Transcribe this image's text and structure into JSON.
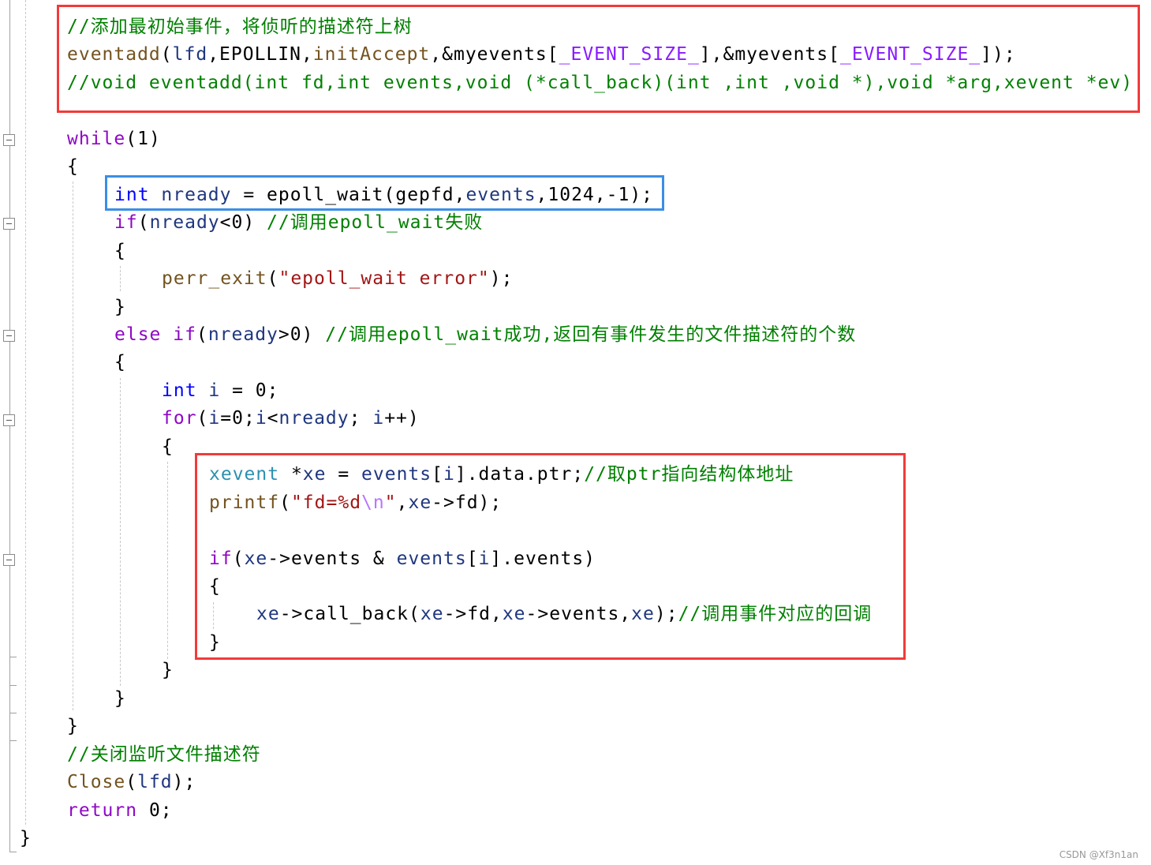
{
  "colors": {
    "comment": "#008000",
    "keyword": "#8f08c4",
    "type": "#0000ff",
    "function": "#74531f",
    "variable": "#1f377f",
    "macro": "#8a1bff",
    "string": "#a31515",
    "highlight_red": "#f23a3a",
    "highlight_blue": "#3a8ee6"
  },
  "code_lines": [
    {
      "indent": 1,
      "tokens": [
        [
          "//添加最初始事件，将侦听的描述符上树",
          "comment"
        ]
      ]
    },
    {
      "indent": 1,
      "tokens": [
        [
          "eventadd",
          "fn"
        ],
        [
          "(",
          "plain"
        ],
        [
          "lfd",
          "var"
        ],
        [
          ",EPOLLIN,",
          "plain"
        ],
        [
          "initAccept",
          "fn"
        ],
        [
          ",&myevents[",
          "plain"
        ],
        [
          "_EVENT_SIZE_",
          "macro"
        ],
        [
          "],&myevents[",
          "plain"
        ],
        [
          "_EVENT_SIZE_",
          "macro"
        ],
        [
          "]);",
          "plain"
        ]
      ]
    },
    {
      "indent": 1,
      "tokens": [
        [
          "//void eventadd(int fd,int events,void (*call_back)(int ,int ,void *),void *arg,xevent *ev)",
          "comment"
        ]
      ]
    },
    {
      "indent": 1,
      "tokens": []
    },
    {
      "indent": 1,
      "tokens": [
        [
          "while",
          "kw"
        ],
        [
          "(1)",
          "plain"
        ]
      ]
    },
    {
      "indent": 1,
      "tokens": [
        [
          "{",
          "plain"
        ]
      ]
    },
    {
      "indent": 2,
      "tokens": [
        [
          "int",
          "type"
        ],
        [
          " ",
          "plain"
        ],
        [
          "nready",
          "var"
        ],
        [
          " = epoll_wait(gepfd,",
          "plain"
        ],
        [
          "events",
          "var"
        ],
        [
          ",1024,-1);",
          "plain"
        ]
      ]
    },
    {
      "indent": 2,
      "tokens": [
        [
          "if",
          "kw"
        ],
        [
          "(",
          "plain"
        ],
        [
          "nready",
          "var"
        ],
        [
          "<0) ",
          "plain"
        ],
        [
          "//调用epoll_wait失败",
          "comment"
        ]
      ]
    },
    {
      "indent": 2,
      "tokens": [
        [
          "{",
          "plain"
        ]
      ]
    },
    {
      "indent": 3,
      "tokens": [
        [
          "perr_exit",
          "fn"
        ],
        [
          "(",
          "plain"
        ],
        [
          "\"epoll_wait error\"",
          "str"
        ],
        [
          ");",
          "plain"
        ]
      ]
    },
    {
      "indent": 2,
      "tokens": [
        [
          "}",
          "plain"
        ]
      ]
    },
    {
      "indent": 2,
      "tokens": [
        [
          "else",
          "kw"
        ],
        [
          " ",
          "plain"
        ],
        [
          "if",
          "kw"
        ],
        [
          "(",
          "plain"
        ],
        [
          "nready",
          "var"
        ],
        [
          ">0) ",
          "plain"
        ],
        [
          "//调用epoll_wait成功,返回有事件发生的文件描述符的个数",
          "comment"
        ]
      ]
    },
    {
      "indent": 2,
      "tokens": [
        [
          "{",
          "plain"
        ]
      ]
    },
    {
      "indent": 3,
      "tokens": [
        [
          "int",
          "type"
        ],
        [
          " ",
          "plain"
        ],
        [
          "i",
          "var"
        ],
        [
          " = 0;",
          "plain"
        ]
      ]
    },
    {
      "indent": 3,
      "tokens": [
        [
          "for",
          "kw"
        ],
        [
          "(",
          "plain"
        ],
        [
          "i",
          "var"
        ],
        [
          "=0;",
          "plain"
        ],
        [
          "i",
          "var"
        ],
        [
          "<",
          "plain"
        ],
        [
          "nready",
          "var"
        ],
        [
          "; ",
          "plain"
        ],
        [
          "i",
          "var"
        ],
        [
          "++)",
          "plain"
        ]
      ]
    },
    {
      "indent": 3,
      "tokens": [
        [
          "{",
          "plain"
        ]
      ]
    },
    {
      "indent": 4,
      "tokens": [
        [
          "xevent",
          "cls"
        ],
        [
          " *",
          "plain"
        ],
        [
          "xe",
          "var"
        ],
        [
          " = ",
          "plain"
        ],
        [
          "events",
          "var"
        ],
        [
          "[",
          "plain"
        ],
        [
          "i",
          "var"
        ],
        [
          "].data.ptr;",
          "plain"
        ],
        [
          "//取ptr指向结构体地址",
          "comment"
        ]
      ]
    },
    {
      "indent": 4,
      "tokens": [
        [
          "printf",
          "fn"
        ],
        [
          "(",
          "plain"
        ],
        [
          "\"fd=%d",
          "str"
        ],
        [
          "\\n",
          "esc"
        ],
        [
          "\"",
          "str"
        ],
        [
          ",",
          "plain"
        ],
        [
          "xe",
          "var"
        ],
        [
          "->fd);",
          "plain"
        ]
      ]
    },
    {
      "indent": 4,
      "tokens": []
    },
    {
      "indent": 4,
      "tokens": [
        [
          "if",
          "kw"
        ],
        [
          "(",
          "plain"
        ],
        [
          "xe",
          "var"
        ],
        [
          "->events & ",
          "plain"
        ],
        [
          "events",
          "var"
        ],
        [
          "[",
          "plain"
        ],
        [
          "i",
          "var"
        ],
        [
          "].events)",
          "plain"
        ]
      ]
    },
    {
      "indent": 4,
      "tokens": [
        [
          "{",
          "plain"
        ]
      ]
    },
    {
      "indent": 5,
      "tokens": [
        [
          "xe",
          "var"
        ],
        [
          "->call_back(",
          "plain"
        ],
        [
          "xe",
          "var"
        ],
        [
          "->fd,",
          "plain"
        ],
        [
          "xe",
          "var"
        ],
        [
          "->events,",
          "plain"
        ],
        [
          "xe",
          "var"
        ],
        [
          ");",
          "plain"
        ],
        [
          "//调用事件对应的回调",
          "comment"
        ]
      ]
    },
    {
      "indent": 4,
      "tokens": [
        [
          "}",
          "plain"
        ]
      ]
    },
    {
      "indent": 3,
      "tokens": [
        [
          "}",
          "plain"
        ]
      ]
    },
    {
      "indent": 2,
      "tokens": [
        [
          "}",
          "plain"
        ]
      ]
    },
    {
      "indent": 1,
      "tokens": [
        [
          "}",
          "plain"
        ]
      ]
    },
    {
      "indent": 1,
      "tokens": [
        [
          "//关闭监听文件描述符",
          "comment"
        ]
      ]
    },
    {
      "indent": 1,
      "tokens": [
        [
          "Close",
          "fn"
        ],
        [
          "(",
          "plain"
        ],
        [
          "lfd",
          "var"
        ],
        [
          ");",
          "plain"
        ]
      ]
    },
    {
      "indent": 1,
      "tokens": [
        [
          "return",
          "kw"
        ],
        [
          " 0;",
          "plain"
        ]
      ]
    },
    {
      "indent": 0,
      "tokens": [
        [
          "}",
          "plain"
        ]
      ]
    }
  ],
  "watermark": "CSDN @Xf3n1an"
}
